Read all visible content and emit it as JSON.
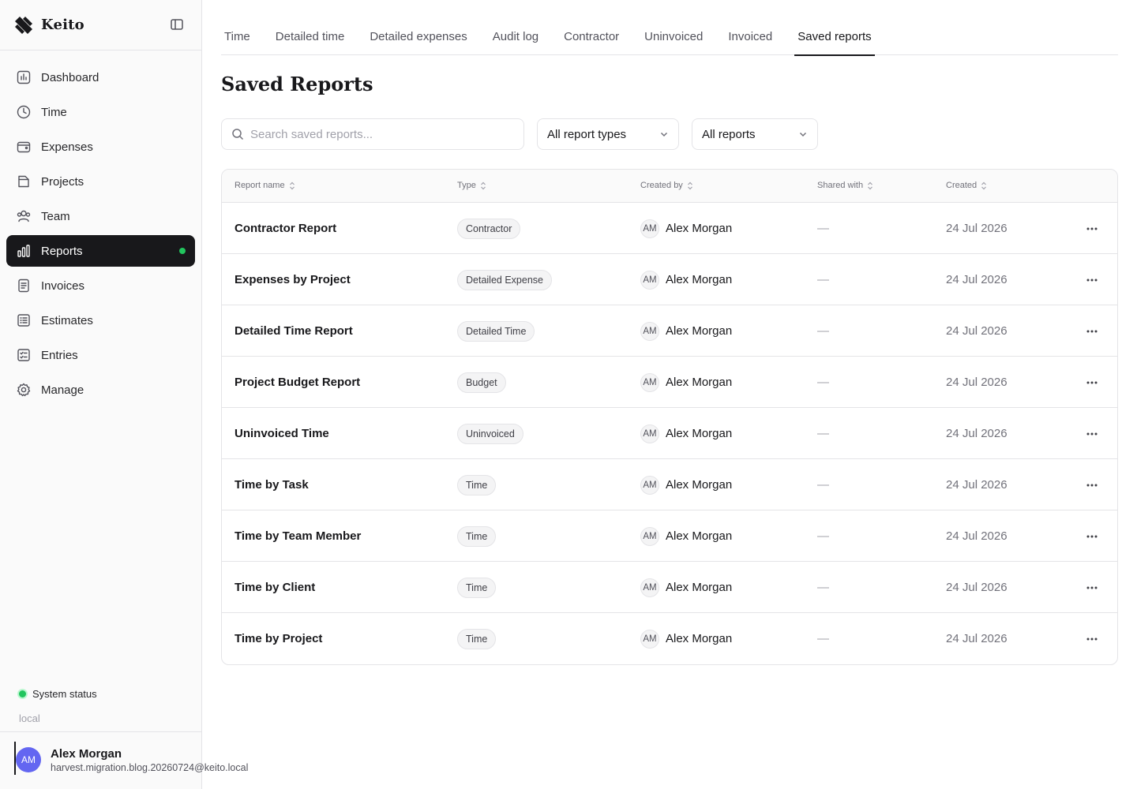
{
  "app": {
    "name": "Keito"
  },
  "sidebar": {
    "items": [
      {
        "key": "dashboard",
        "label": "Dashboard",
        "icon": "bar-chart-icon"
      },
      {
        "key": "time",
        "label": "Time",
        "icon": "clock-icon"
      },
      {
        "key": "expenses",
        "label": "Expenses",
        "icon": "wallet-icon"
      },
      {
        "key": "projects",
        "label": "Projects",
        "icon": "folder-icon"
      },
      {
        "key": "team",
        "label": "Team",
        "icon": "users-icon"
      },
      {
        "key": "reports",
        "label": "Reports",
        "icon": "bars-icon",
        "active": true
      },
      {
        "key": "invoices",
        "label": "Invoices",
        "icon": "document-icon"
      },
      {
        "key": "estimates",
        "label": "Estimates",
        "icon": "list-icon"
      },
      {
        "key": "entries",
        "label": "Entries",
        "icon": "checklist-icon"
      },
      {
        "key": "manage",
        "label": "Manage",
        "icon": "gear-icon"
      }
    ],
    "status_label": "System status",
    "environment": "local",
    "status_color": "#22c55e"
  },
  "user": {
    "initials": "AM",
    "name": "Alex Morgan",
    "email": "harvest.migration.blog.20260724@keito.local",
    "avatar_color": "#6366f1"
  },
  "tabs": [
    {
      "label": "Time"
    },
    {
      "label": "Detailed time"
    },
    {
      "label": "Detailed expenses"
    },
    {
      "label": "Audit log"
    },
    {
      "label": "Contractor"
    },
    {
      "label": "Uninvoiced"
    },
    {
      "label": "Invoiced"
    },
    {
      "label": "Saved reports",
      "active": true
    }
  ],
  "page": {
    "title": "Saved Reports",
    "search_placeholder": "Search saved reports...",
    "type_filter": "All report types",
    "owner_filter": "All reports"
  },
  "table": {
    "columns": [
      "Report name",
      "Type",
      "Created by",
      "Shared with",
      "Created"
    ],
    "rows": [
      {
        "name": "Contractor Report",
        "type": "Contractor",
        "creator_initials": "AM",
        "creator": "Alex Morgan",
        "shared": "—",
        "created": "24 Jul 2026"
      },
      {
        "name": "Expenses by Project",
        "type": "Detailed Expense",
        "creator_initials": "AM",
        "creator": "Alex Morgan",
        "shared": "—",
        "created": "24 Jul 2026"
      },
      {
        "name": "Detailed Time Report",
        "type": "Detailed Time",
        "creator_initials": "AM",
        "creator": "Alex Morgan",
        "shared": "—",
        "created": "24 Jul 2026"
      },
      {
        "name": "Project Budget Report",
        "type": "Budget",
        "creator_initials": "AM",
        "creator": "Alex Morgan",
        "shared": "—",
        "created": "24 Jul 2026"
      },
      {
        "name": "Uninvoiced Time",
        "type": "Uninvoiced",
        "creator_initials": "AM",
        "creator": "Alex Morgan",
        "shared": "—",
        "created": "24 Jul 2026"
      },
      {
        "name": "Time by Task",
        "type": "Time",
        "creator_initials": "AM",
        "creator": "Alex Morgan",
        "shared": "—",
        "created": "24 Jul 2026"
      },
      {
        "name": "Time by Team Member",
        "type": "Time",
        "creator_initials": "AM",
        "creator": "Alex Morgan",
        "shared": "—",
        "created": "24 Jul 2026"
      },
      {
        "name": "Time by Client",
        "type": "Time",
        "creator_initials": "AM",
        "creator": "Alex Morgan",
        "shared": "—",
        "created": "24 Jul 2026"
      },
      {
        "name": "Time by Project",
        "type": "Time",
        "creator_initials": "AM",
        "creator": "Alex Morgan",
        "shared": "—",
        "created": "24 Jul 2026"
      }
    ]
  }
}
